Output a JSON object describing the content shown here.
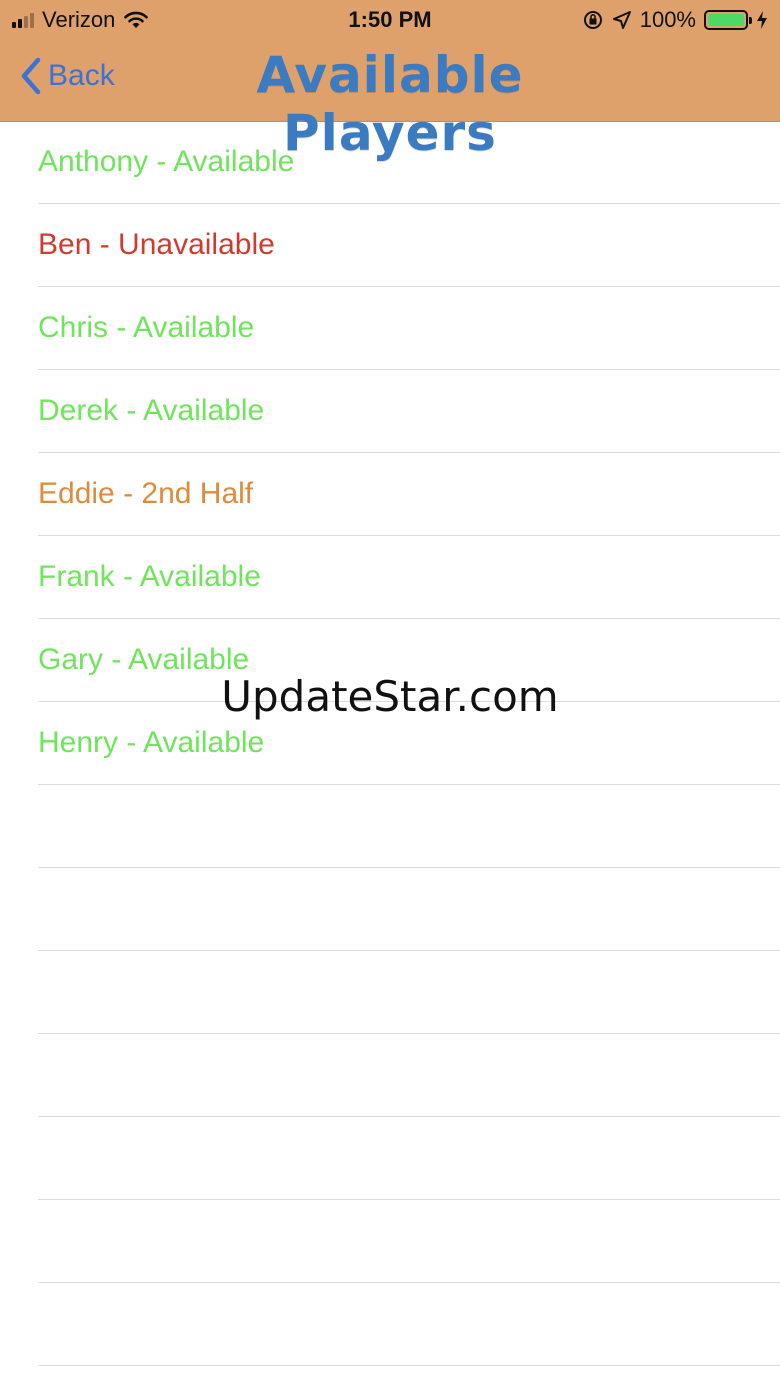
{
  "status_bar": {
    "carrier": "Verizon",
    "time": "1:50 PM",
    "battery_percent_text": "100%",
    "battery_level": 1.0
  },
  "nav": {
    "back_label": "Back",
    "title": "Available Players"
  },
  "colors": {
    "available": "#6ee55a",
    "unavailable": "#d13b2e",
    "partial": "#e08a3c",
    "header_bg": "#dfa16b",
    "back": "#3b72d8",
    "title": "#3a7bc1"
  },
  "players": [
    {
      "text": "Anthony - Available",
      "status": "available"
    },
    {
      "text": "Ben - Unavailable",
      "status": "unavailable"
    },
    {
      "text": "Chris - Available",
      "status": "available"
    },
    {
      "text": "Derek - Available",
      "status": "available"
    },
    {
      "text": "Eddie - 2nd Half",
      "status": "partial"
    },
    {
      "text": "Frank - Available",
      "status": "available"
    },
    {
      "text": "Gary - Available",
      "status": "available"
    },
    {
      "text": "Henry - Available",
      "status": "available"
    },
    {
      "text": "",
      "status": "empty"
    },
    {
      "text": "",
      "status": "empty"
    },
    {
      "text": "",
      "status": "empty"
    },
    {
      "text": "",
      "status": "empty"
    },
    {
      "text": "",
      "status": "empty"
    },
    {
      "text": "",
      "status": "empty"
    },
    {
      "text": "",
      "status": "empty"
    }
  ],
  "watermark": "UpdateStar.com"
}
